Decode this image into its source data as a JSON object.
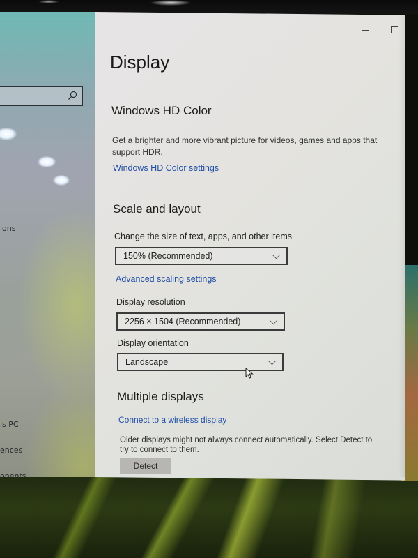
{
  "window": {
    "minimize_icon": "minimize-icon",
    "maximize_icon": "maximize-icon"
  },
  "nav": {
    "search_icon": "search-icon",
    "items": [
      {
        "label": "ions"
      },
      {
        "label": "is PC"
      },
      {
        "label": "ences"
      },
      {
        "label": "onents"
      }
    ]
  },
  "page": {
    "title": "Display"
  },
  "hd_color": {
    "title": "Windows HD Color",
    "description_line1": "Get a brighter and more vibrant picture for videos, games and apps that",
    "description_line2": "support HDR.",
    "settings_link": "Windows HD Color settings"
  },
  "scale_layout": {
    "title": "Scale and layout",
    "scale_label": "Change the size of text, apps, and other items",
    "scale_value": "150% (Recommended)",
    "advanced_link": "Advanced scaling settings",
    "resolution_label": "Display resolution",
    "resolution_value": "2256 × 1504 (Recommended)",
    "orientation_label": "Display orientation",
    "orientation_value": "Landscape"
  },
  "multiple_displays": {
    "title": "Multiple displays",
    "wireless_link": "Connect to a wireless display",
    "detect_note_line1": "Older displays might not always connect automatically. Select Detect to",
    "detect_note_line2": "try to connect to them.",
    "detect_button": "Detect"
  },
  "colors": {
    "link": "#1f4fa8",
    "text": "#1c1c1c",
    "panel_bg": "#e4e3df",
    "button_bg": "#b7b6b2"
  }
}
